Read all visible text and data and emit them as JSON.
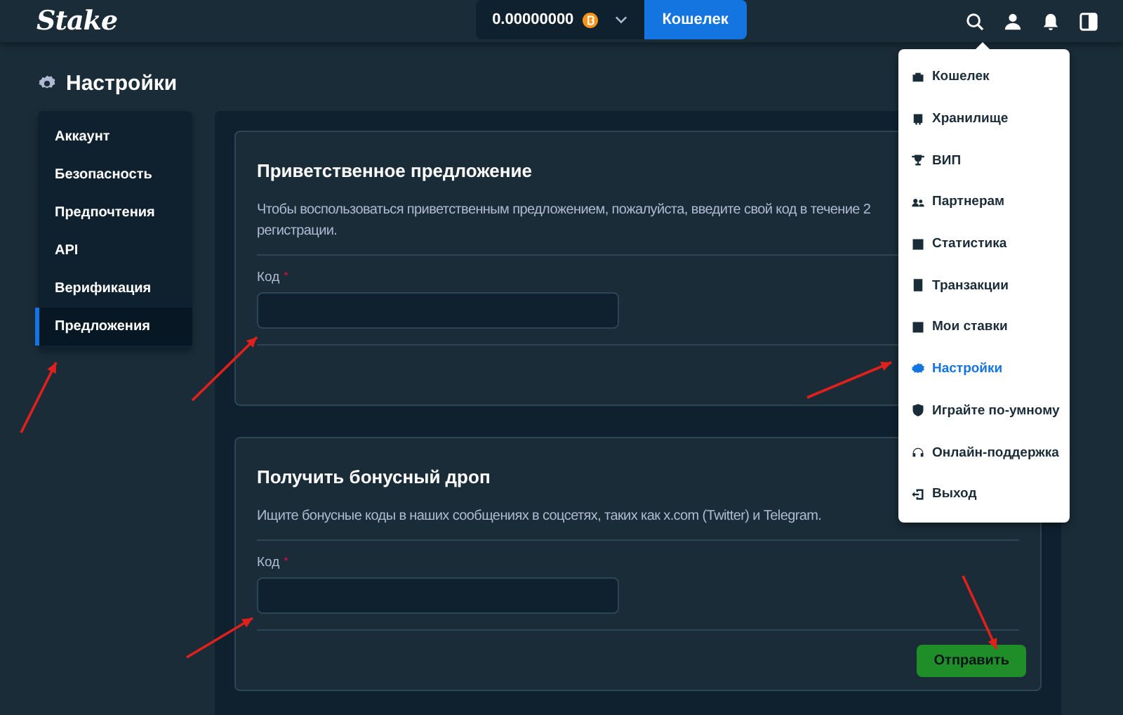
{
  "topbar": {
    "logo": "Stake",
    "balance": "0.00000000",
    "wallet_button": "Кошелек"
  },
  "page": {
    "title": "Настройки"
  },
  "sidebar": {
    "items": [
      {
        "label": "Аккаунт",
        "selected": false
      },
      {
        "label": "Безопасность",
        "selected": false
      },
      {
        "label": "Предпочтения",
        "selected": false
      },
      {
        "label": "API",
        "selected": false
      },
      {
        "label": "Верификация",
        "selected": false
      },
      {
        "label": "Предложения",
        "selected": true
      }
    ]
  },
  "cards": [
    {
      "title": "Приветственное предложение",
      "description_lines": [
        "Чтобы воспользоваться приветственным предложением, пожалуйста, введите свой код в течение 2",
        "регистрации."
      ],
      "field_label": "Код",
      "required_mark": "*"
    },
    {
      "title": "Получить бонусный дроп",
      "description_lines": [
        "Ищите бонусные коды в наших сообщениях в соцсетях, таких как x.com (Twitter) и Telegram."
      ],
      "field_label": "Код",
      "required_mark": "*",
      "submit_button": "Отправить"
    }
  ],
  "user_menu": {
    "items": [
      {
        "label": "Кошелек",
        "selected": false
      },
      {
        "label": "Хранилище",
        "selected": false
      },
      {
        "label": "ВИП",
        "selected": false
      },
      {
        "label": "Партнерам",
        "selected": false
      },
      {
        "label": "Статистика",
        "selected": false
      },
      {
        "label": "Транзакции",
        "selected": false
      },
      {
        "label": "Мои ставки",
        "selected": false
      },
      {
        "label": "Настройки",
        "selected": true
      },
      {
        "label": "Играйте по-умному",
        "selected": false
      },
      {
        "label": "Онлайн-поддержка",
        "selected": false
      },
      {
        "label": "Выход",
        "selected": false
      }
    ]
  },
  "annotations": [
    {
      "kind": "arrow"
    },
    {
      "kind": "arrow"
    },
    {
      "kind": "arrow"
    },
    {
      "kind": "arrow"
    },
    {
      "kind": "arrow"
    }
  ]
}
